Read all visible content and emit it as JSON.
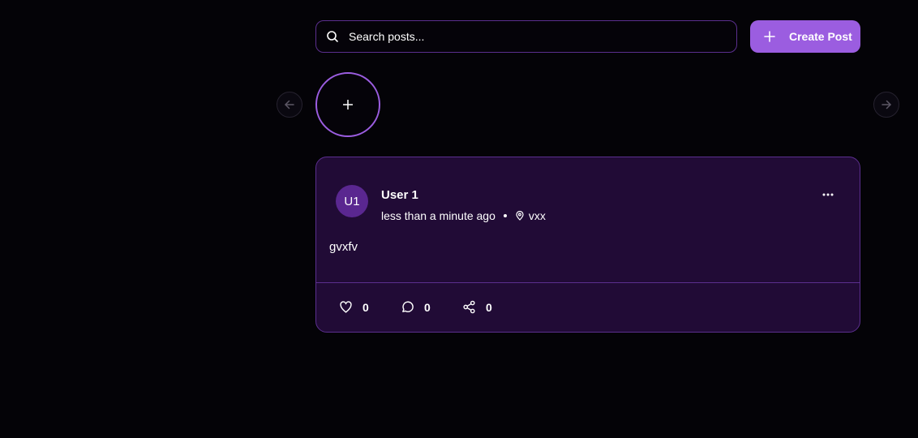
{
  "search": {
    "placeholder": "Search posts..."
  },
  "create_post": {
    "label": "Create Post",
    "icon": "plus-icon"
  },
  "stories": {
    "prev_icon": "arrow-left-icon",
    "next_icon": "arrow-right-icon",
    "add_icon": "plus-icon"
  },
  "post": {
    "avatar_initials": "U1",
    "author": "User 1",
    "time": "less than a minute ago",
    "location": "vxx",
    "content": "gvxfv",
    "likes": "0",
    "comments": "0",
    "shares": "0"
  },
  "colors": {
    "background": "#040307",
    "accent": "#9b5de0",
    "card_bg": "#210b36",
    "border": "#5b2f8e",
    "avatar_bg": "#5a2790"
  }
}
